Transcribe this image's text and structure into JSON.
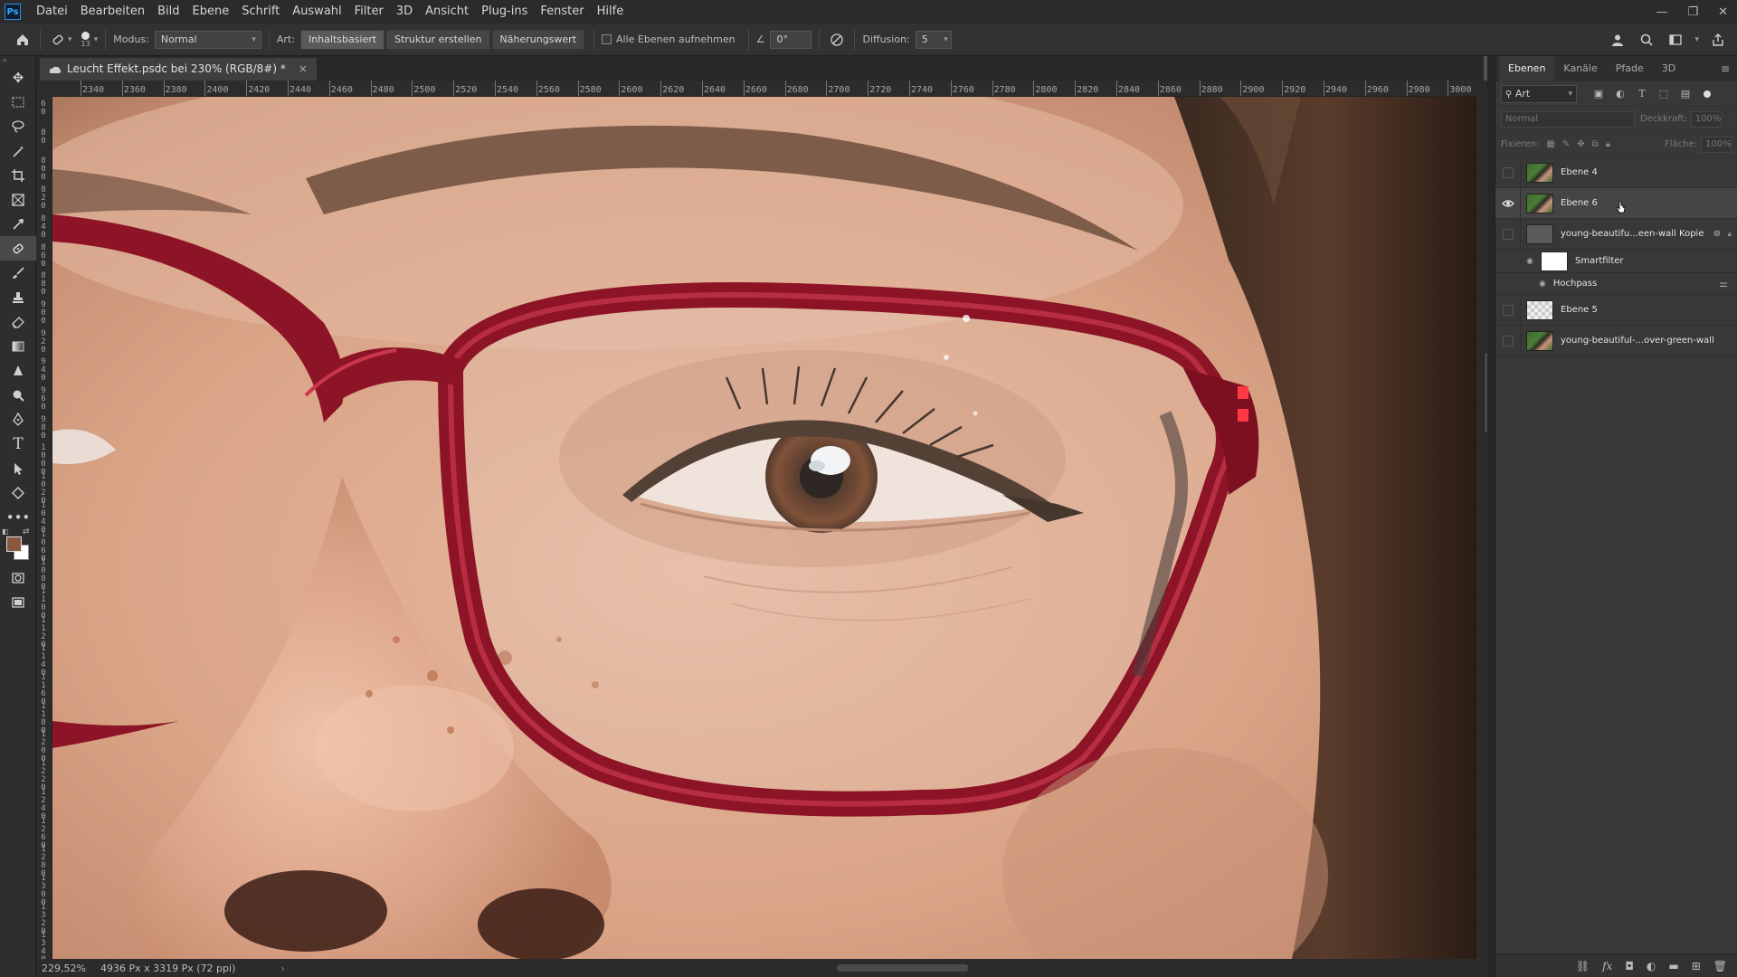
{
  "app": {
    "logo_text": "Ps"
  },
  "menu": [
    "Datei",
    "Bearbeiten",
    "Bild",
    "Ebene",
    "Schrift",
    "Auswahl",
    "Filter",
    "3D",
    "Ansicht",
    "Plug-ins",
    "Fenster",
    "Hilfe"
  ],
  "window_controls": {
    "minimize": "—",
    "restore": "❐",
    "close": "✕"
  },
  "options": {
    "brush_size": "13",
    "mode_label": "Modus:",
    "mode_value": "Normal",
    "type_label": "Art:",
    "type_buttons": [
      "Inhaltsbasiert",
      "Struktur erstellen",
      "Näherungswert"
    ],
    "sample_all_label": "Alle Ebenen aufnehmen",
    "angle_value": "0°",
    "diffusion_label": "Diffusion:",
    "diffusion_value": "5"
  },
  "document": {
    "tab_title": "Leucht Effekt.psdc bei 230% (RGB/8#) *",
    "tab_close": "×"
  },
  "ruler_h": [
    "2340",
    "2360",
    "2380",
    "2400",
    "2420",
    "2440",
    "2460",
    "2480",
    "2500",
    "2520",
    "2540",
    "2560",
    "2580",
    "2600",
    "2620",
    "2640",
    "2660",
    "2680",
    "2700",
    "2720",
    "2740",
    "2760",
    "2780",
    "2800",
    "2820",
    "2840",
    "2860",
    "2880",
    "2900",
    "2920",
    "2940",
    "2960",
    "2980",
    "3000"
  ],
  "ruler_v": [
    "60",
    "80",
    "800",
    "820",
    "840",
    "860",
    "880",
    "900",
    "920",
    "940",
    "960",
    "980",
    "1000",
    "1020",
    "1040",
    "1060",
    "1080",
    "1100",
    "1120",
    "1140",
    "1160",
    "1180",
    "1200",
    "1220",
    "1240",
    "1260",
    "1280",
    "1300",
    "1320",
    "1340"
  ],
  "status": {
    "zoom": "229,52%",
    "doc_info": "4936 Px x 3319 Px (72 ppi)",
    "arrow": "›"
  },
  "panel": {
    "tabs": [
      "Ebenen",
      "Kanäle",
      "Pfade",
      "3D"
    ],
    "kind_filter": "Art",
    "blend_mode": "Normal",
    "opacity_label": "Deckkraft:",
    "opacity_value": "100%",
    "lock_label": "Fixieren:",
    "fill_label": "Fläche:",
    "fill_value": "100%",
    "layers": [
      {
        "name": "Ebene 4",
        "visible": false,
        "thumb": "photo"
      },
      {
        "name": "Ebene 6",
        "visible": true,
        "thumb": "photo",
        "selected": true
      },
      {
        "name": "young-beautifu...een-wall Kopie",
        "visible": false,
        "thumb": "smart"
      },
      {
        "name": "Ebene 5",
        "visible": false,
        "thumb": "transparent"
      },
      {
        "name": "young-beautiful-...over-green-wall",
        "visible": false,
        "thumb": "photo"
      }
    ],
    "smartfilter": {
      "label": "Smartfilter",
      "filter_name": "Hochpass"
    }
  },
  "colors": {
    "foreground": "#8a5a40",
    "background": "#ffffff",
    "accent": "#31a8ff"
  }
}
